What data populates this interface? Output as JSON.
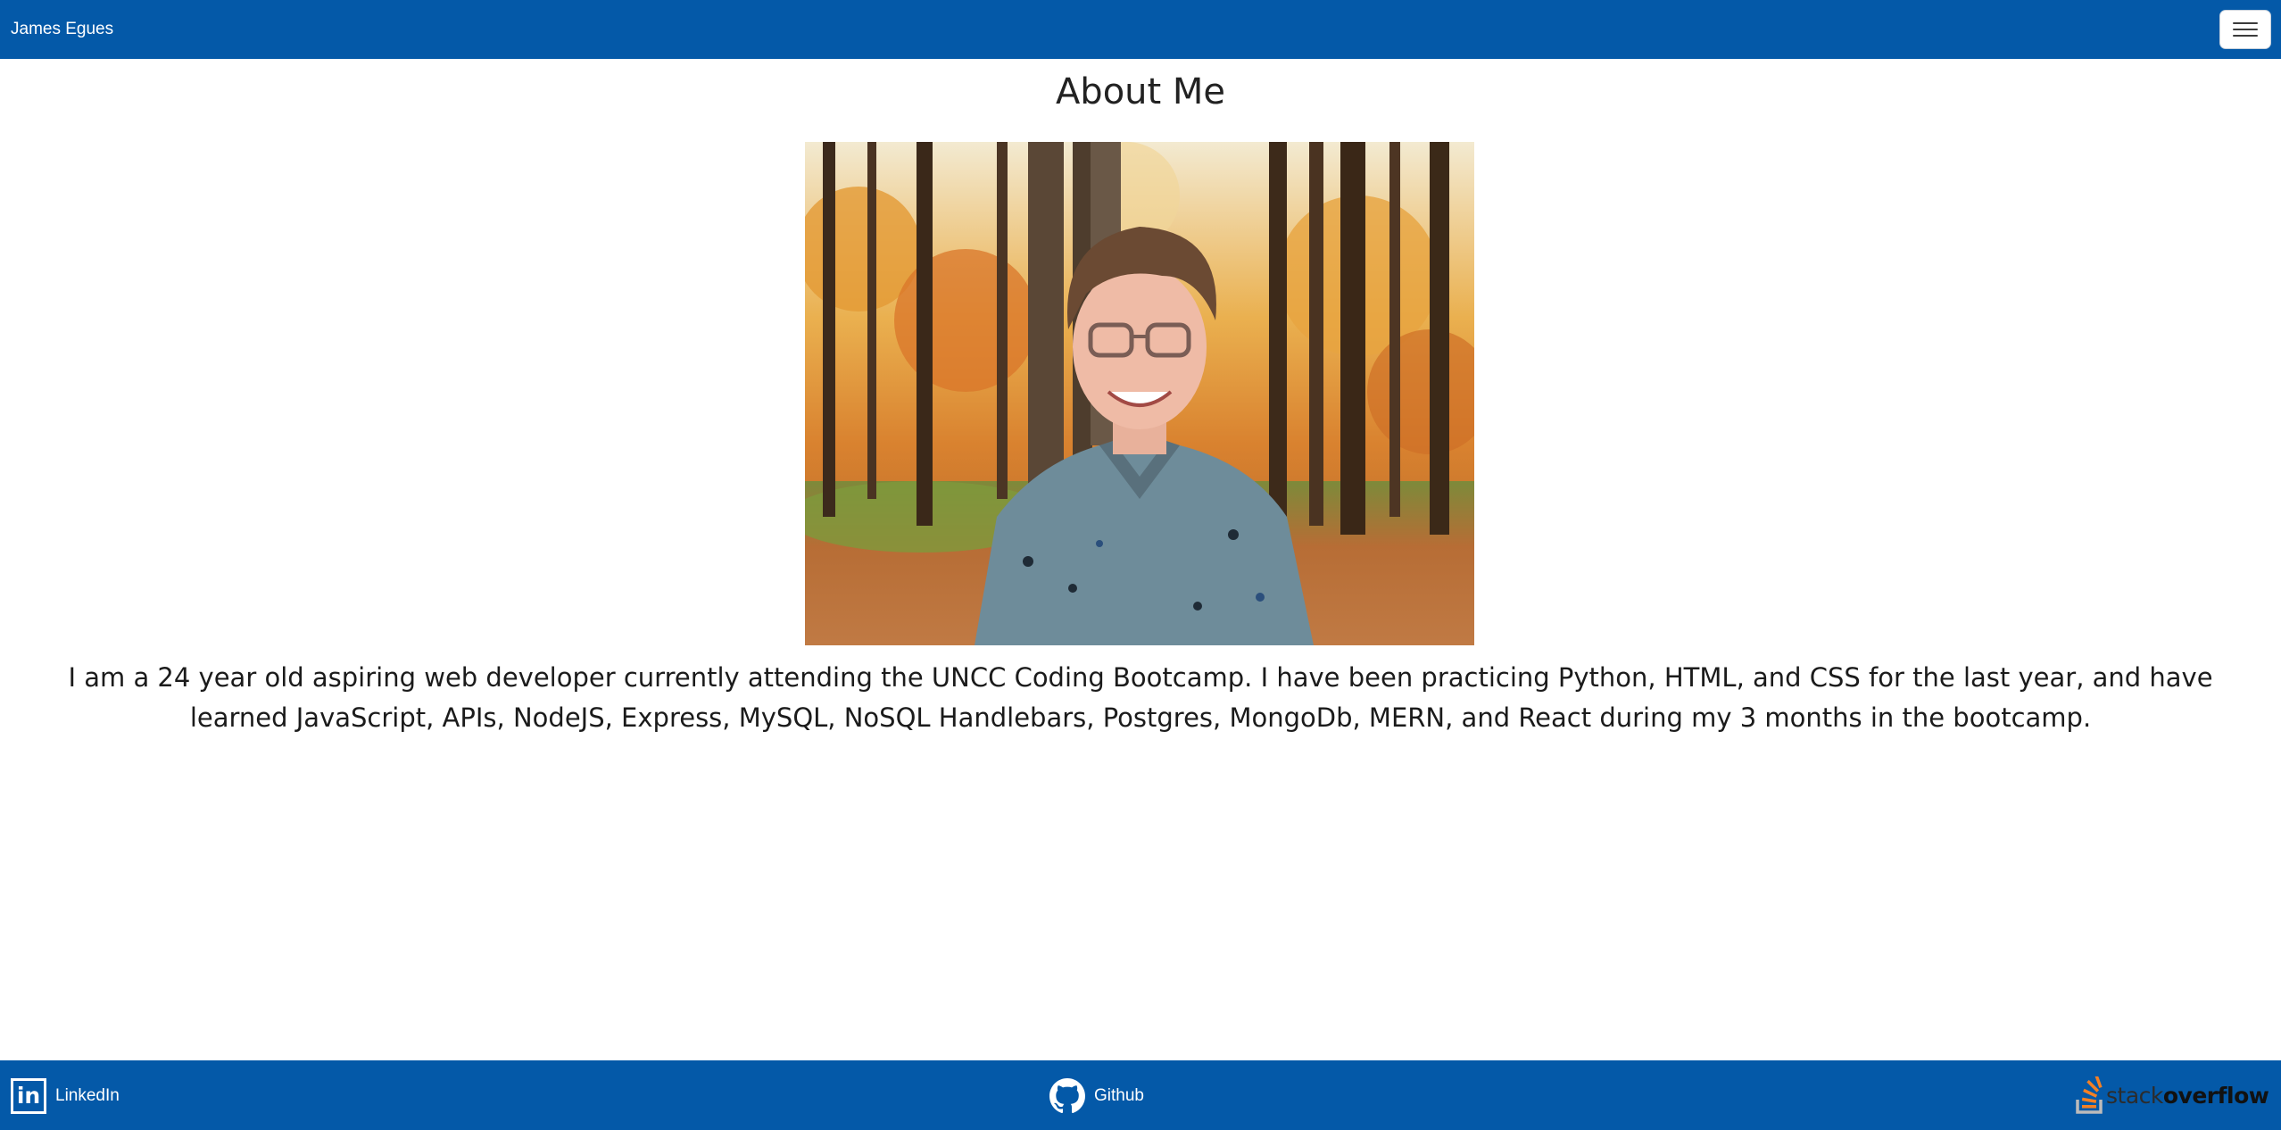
{
  "navbar": {
    "brand": "James Egues",
    "toggle_icon": "hamburger-menu-icon"
  },
  "main": {
    "title": "About Me",
    "photo_alt": "Portrait of James Egues in an autumn forest",
    "bio": "I am a 24 year old aspiring web developer currently attending the UNCC Coding Bootcamp. I have been practicing Python, HTML, and CSS for the last year, and have learned JavaScript, APIs, NodeJS, Express, MySQL, NoSQL Handlebars, Postgres, MongoDb, MERN, and React during my 3 months in the bootcamp."
  },
  "footer": {
    "linkedin": {
      "icon": "linkedin-icon",
      "label": "LinkedIn",
      "icon_text": "in"
    },
    "github": {
      "icon": "github-icon",
      "label": "Github"
    },
    "stackoverflow": {
      "icon": "stackoverflow-icon",
      "label_light": "stack",
      "label_bold": "overflow"
    }
  },
  "colors": {
    "nav_bg": "#0459a8",
    "footer_bg": "#0459a8",
    "text": "#222222",
    "so_orange": "#f48024"
  }
}
